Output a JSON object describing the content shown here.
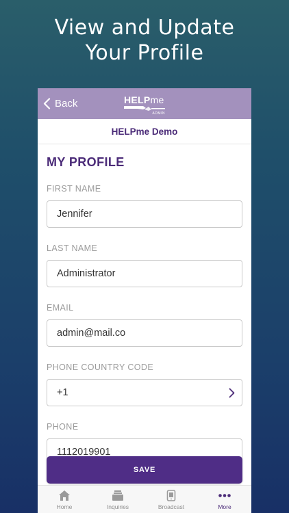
{
  "promo": {
    "title_line1": "View and Update",
    "title_line2": "Your Profile"
  },
  "navbar": {
    "back_label": "Back",
    "logo_word_bold": "HELP",
    "logo_word_light": "me",
    "logo_sub": "ADMIN"
  },
  "org": {
    "name": "HELPme Demo"
  },
  "profile": {
    "heading": "MY PROFILE",
    "first_name": {
      "label": "FIRST NAME",
      "value": "Jennifer"
    },
    "last_name": {
      "label": "LAST NAME",
      "value": "Administrator"
    },
    "email": {
      "label": "EMAIL",
      "value": "admin@mail.co"
    },
    "country_code": {
      "label": "PHONE COUNTRY CODE",
      "value": "+1"
    },
    "phone": {
      "label": "PHONE",
      "value": "1112019901"
    },
    "save_label": "SAVE"
  },
  "tabs": [
    {
      "label": "Home",
      "icon": "home-icon"
    },
    {
      "label": "Inquiries",
      "icon": "inbox-icon"
    },
    {
      "label": "Broadcast",
      "icon": "broadcast-icon"
    },
    {
      "label": "More",
      "icon": "more-icon"
    }
  ],
  "colors": {
    "accent": "#4b2b78",
    "navbar": "#a391bd",
    "button": "#4f2d86"
  }
}
